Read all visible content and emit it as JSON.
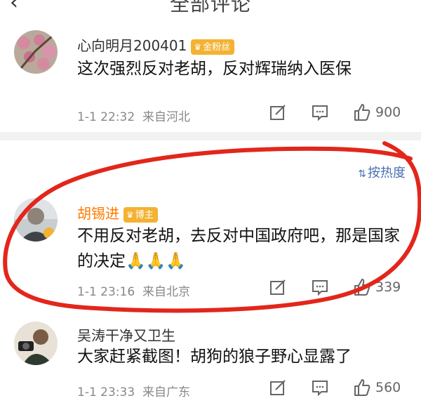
{
  "header": {
    "title": "全部评论",
    "back_icon": "‹",
    "more_icon": "⋯"
  },
  "sort": {
    "label": "按热度",
    "icon": "⇅"
  },
  "comments": [
    {
      "username": "心向明月200401",
      "badge": "金粉丝",
      "text": "这次强烈反对老胡，反对辉瑞纳入医保",
      "time": "1-1 22:32",
      "location": "来自河北",
      "likes": "900"
    },
    {
      "username": "胡锡进",
      "badge": "博主",
      "text": "不用反对老胡，去反对中国政府吧，那是国家的决定🙏🙏🙏",
      "time": "1-1 23:16",
      "location": "来自北京",
      "likes": "339"
    },
    {
      "username": "吴涛干净又卫生",
      "badge": "",
      "text": "大家赶紧截图！胡狗的狼子野心显露了",
      "time": "1-1 23:33",
      "location": "来自广东",
      "likes": "560"
    }
  ],
  "colors": {
    "accent": "#ff7a00",
    "badge": "#f3b232",
    "circle": "#e3261b",
    "link": "#4a6fb0"
  }
}
